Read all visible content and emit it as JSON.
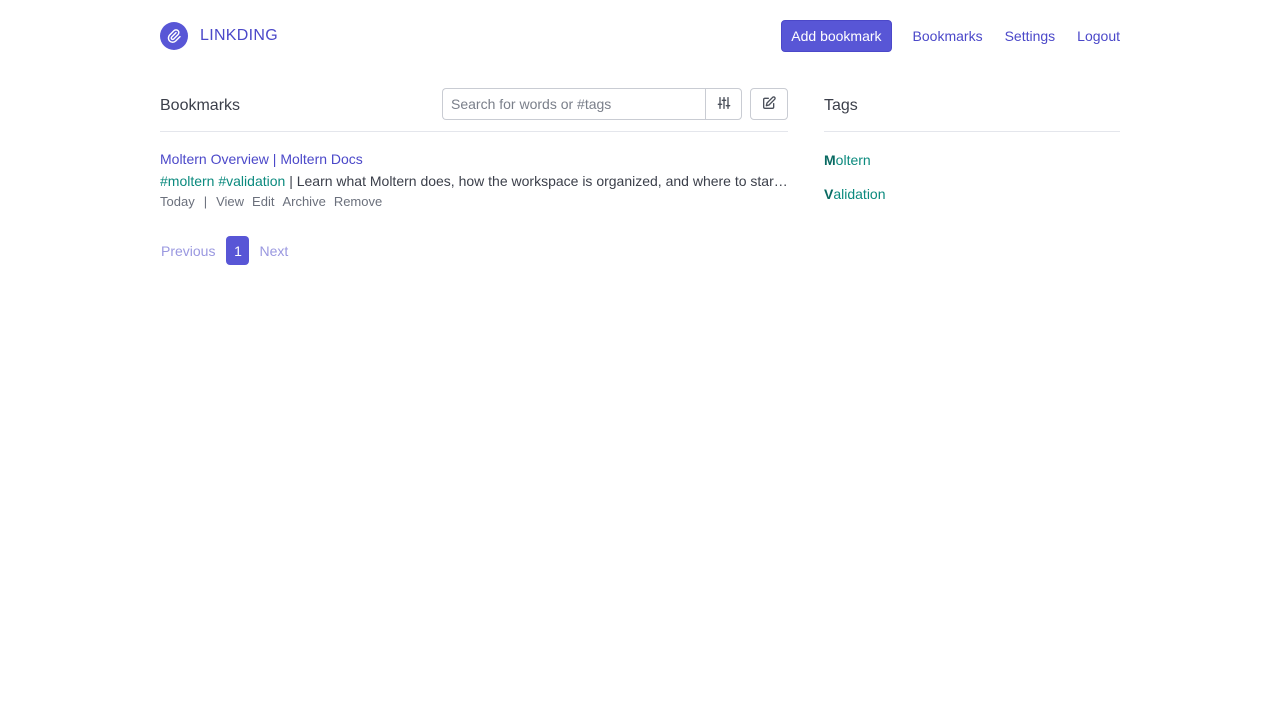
{
  "header": {
    "brand": "LINKDING",
    "nav": {
      "add_bookmark": "Add bookmark",
      "bookmarks": "Bookmarks",
      "settings": "Settings",
      "logout": "Logout"
    }
  },
  "main": {
    "title": "Bookmarks",
    "search": {
      "placeholder": "Search for words or #tags",
      "value": ""
    },
    "bookmarks": [
      {
        "title": "Moltern Overview | Moltern Docs",
        "tags": [
          "#moltern",
          "#validation"
        ],
        "separator": "|",
        "description": "Learn what Moltern does, how the workspace is organized, and where to start with templates and exports.",
        "date": "Today",
        "date_separator": "|",
        "actions": [
          "View",
          "Edit",
          "Archive",
          "Remove"
        ]
      }
    ],
    "pagination": {
      "previous": "Previous",
      "current": "1",
      "next": "Next"
    }
  },
  "sidebar": {
    "title": "Tags",
    "tags": [
      {
        "first": "M",
        "rest": "oltern"
      },
      {
        "first": "V",
        "rest": "alidation"
      }
    ]
  },
  "colors": {
    "accent": "#5856d6",
    "link": "#4b48c9",
    "tag": "#0b8a7e"
  }
}
